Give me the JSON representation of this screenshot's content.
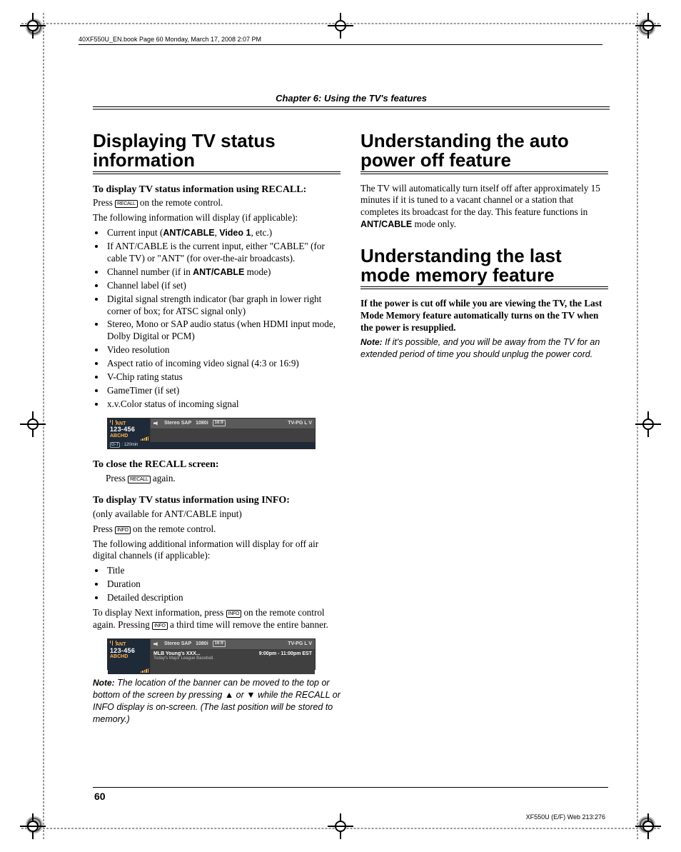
{
  "runhead": "40XF550U_EN.book  Page 60  Monday, March 17, 2008  2:07 PM",
  "chapter": "Chapter 6: Using the TV's features",
  "page_number": "60",
  "footer_right": "XF550U (E/F) Web 213:276",
  "keycaps": {
    "recall": "RECALL",
    "info": "INFO"
  },
  "left": {
    "h1": "Displaying TV status information",
    "sub1": "To display TV status information using RECALL:",
    "p1a": "Press ",
    "p1b": " on the remote control.",
    "p2": "The following information will display (if applicable):",
    "bullets1": [
      {
        "pre": "Current input (",
        "b1": "ANT/CABLE",
        "mid": ", ",
        "b2": "Video 1",
        "post": ", etc.)"
      },
      {
        "text": "If ANT/CABLE is the current input, either \"CABLE\" (for cable TV) or \"ANT\" (for over-the-air broadcasts)."
      },
      {
        "pre": "Channel number (if in ",
        "b1": "ANT/CABLE",
        "post": " mode)"
      },
      {
        "text": "Channel label (if set)"
      },
      {
        "text": "Digital signal strength indicator (bar graph in lower right corner of box; for ATSC signal only)"
      },
      {
        "text": "Stereo, Mono or SAP audio status (when HDMI input mode, Dolby Digital or PCM)"
      },
      {
        "text": "Video resolution"
      },
      {
        "text": "Aspect ratio of incoming video signal (4:3 or 16:9)"
      },
      {
        "text": "V-Chip rating status"
      },
      {
        "text": "GameTimer (if set)"
      },
      {
        "text": "x.v.Color status of incoming signal"
      }
    ],
    "sub2": "To close the RECALL screen:",
    "p3a": "Press ",
    "p3b": " again.",
    "sub3": "To display TV status information using INFO:",
    "p4": "(only available for ANT/CABLE input)",
    "p5a": "Press ",
    "p5b": " on the remote control.",
    "p6": "The following additional information will display for off air digital channels (if applicable):",
    "bullets2": [
      {
        "text": "Title"
      },
      {
        "text": "Duration"
      },
      {
        "text": "Detailed description"
      }
    ],
    "p7a": "To display Next information, press  ",
    "p7b": " on the remote control again. Pressing ",
    "p7c": " a third time will remove the entire banner.",
    "note_label": "Note:",
    "note": " The location of the banner can be moved to the top or bottom of the screen by pressing ▲ or ▼ while the RECALL or INFO display is on-screen. (The last position will be stored to memory.)"
  },
  "osd": {
    "ant": "ANT",
    "channel": "123-456",
    "label": "ABCHD",
    "audio": "Stereo SAP",
    "res": "1080i",
    "aspect": "16:9",
    "rating": "TV-PG  L  V",
    "gt_badge": "G-T",
    "gt_time": ": 120min",
    "program_title": "MLB Young's XXX...",
    "program_time": "9:00pm - 11:00pm EST",
    "program_desc": "Today's Major League Baseball."
  },
  "right": {
    "h1a": "Understanding the auto power off feature",
    "p_a1": "The TV will automatically turn itself off after approximately 15 minutes if it is tuned to a vacant channel or a station that completes its broadcast for the day. This feature functions in ",
    "p_a1b": "ANT/CABLE",
    "p_a1c": " mode only.",
    "h1b": "Understanding the last mode memory feature",
    "p_b1": "If the power is cut off while you are viewing the TV, the Last Mode Memory feature automatically turns on the TV when the power is resupplied.",
    "note_label": "Note:",
    "note": " If it's possible, and you will be away from the TV for an extended period of time you should unplug the power cord."
  }
}
